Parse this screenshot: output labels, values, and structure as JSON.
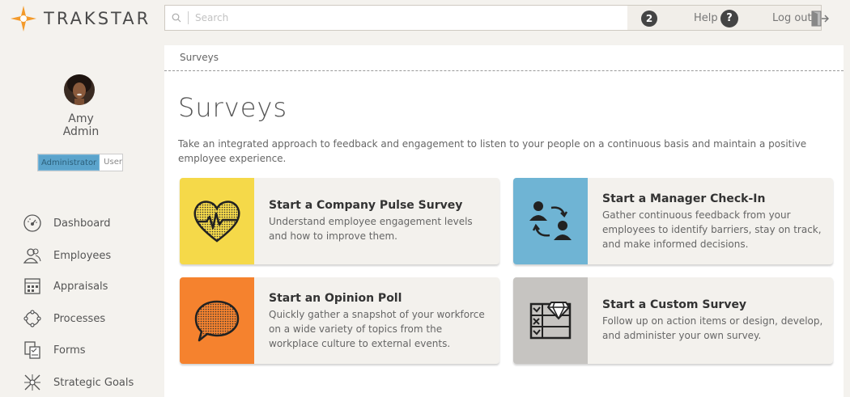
{
  "app": {
    "logo_text": "TRAKSTAR",
    "brand_color": "#f39a2b"
  },
  "search": {
    "placeholder": "Search"
  },
  "header": {
    "notifications_count": "2",
    "help_label": "Help",
    "help_icon_glyph": "?",
    "logout_label": "Log out"
  },
  "user": {
    "first_name": "Amy",
    "last_name": "Admin",
    "role_admin": "Administrator",
    "role_user": "User"
  },
  "sidebar": {
    "items": [
      {
        "label": "Dashboard",
        "icon": "dashboard-icon"
      },
      {
        "label": "Employees",
        "icon": "employees-icon"
      },
      {
        "label": "Appraisals",
        "icon": "appraisals-icon"
      },
      {
        "label": "Processes",
        "icon": "processes-icon"
      },
      {
        "label": "Forms",
        "icon": "forms-icon"
      },
      {
        "label": "Strategic Goals",
        "icon": "strategic-goals-icon"
      }
    ]
  },
  "breadcrumb": "Surveys",
  "page": {
    "title": "Surveys",
    "intro": "Take an integrated approach to feedback and engagement to listen to your people on a continuous basis and maintain a positive employee experience."
  },
  "cards": [
    {
      "title": "Start a Company Pulse Survey",
      "description": "Understand employee engagement levels and how to improve them.",
      "color": "#f5d949",
      "icon": "heart-pulse-icon"
    },
    {
      "title": "Start a Manager Check-In",
      "description": "Gather continuous feedback from your employees to identify barriers, stay on track, and make informed decisions.",
      "color": "#6fb4d4",
      "icon": "check-in-icon"
    },
    {
      "title": "Start an Opinion Poll",
      "description": "Quickly gather a snapshot of your workforce on a wide variety of topics from the workplace culture to external events.",
      "color": "#f5822e",
      "icon": "speech-bubble-icon"
    },
    {
      "title": "Start a Custom Survey",
      "description": "Follow up on action items or design, develop, and administer your own survey.",
      "color": "#c6c4c1",
      "icon": "custom-survey-icon"
    }
  ]
}
